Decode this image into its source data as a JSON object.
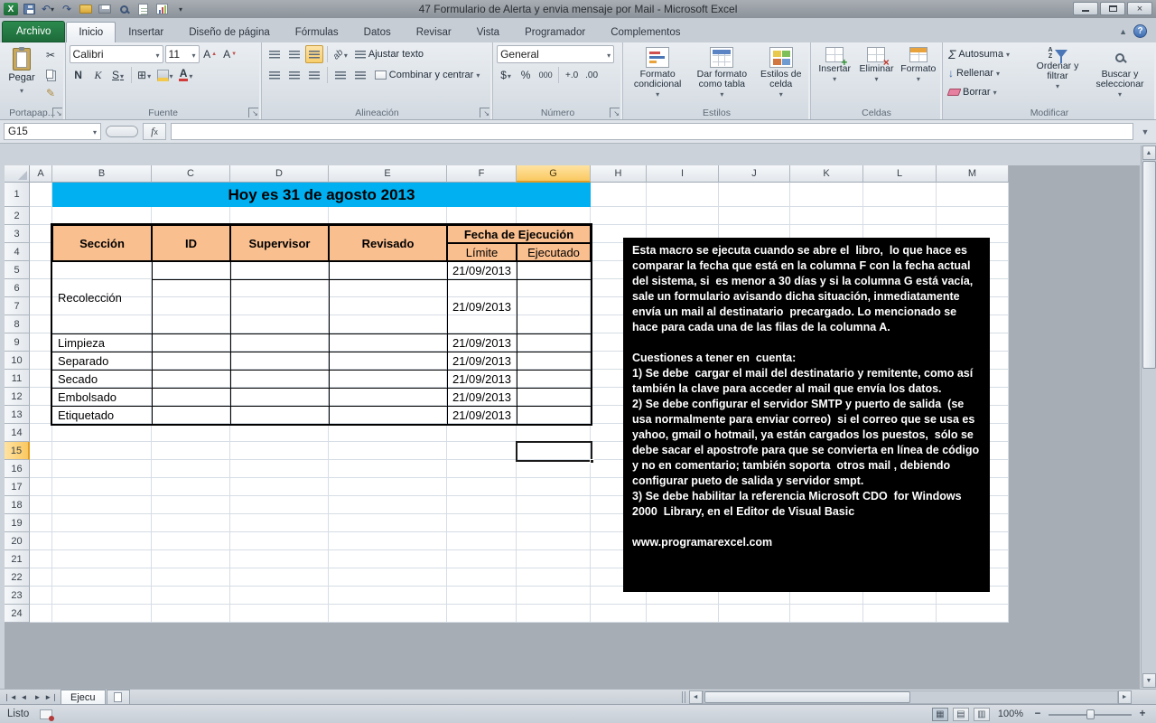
{
  "window": {
    "title": "47 Formulario de Alerta y envia mensaje por Mail  -  Microsoft Excel"
  },
  "ribbon": {
    "file_tab": "Archivo",
    "tabs": [
      "Inicio",
      "Insertar",
      "Diseño de página",
      "Fórmulas",
      "Datos",
      "Revisar",
      "Vista",
      "Programador",
      "Complementos"
    ],
    "active_tab": "Inicio",
    "groups": {
      "clipboard": {
        "label": "Portapap...",
        "paste": "Pegar"
      },
      "font": {
        "label": "Fuente",
        "font_name": "Calibri",
        "font_size": "11",
        "bold": "N",
        "italic": "K",
        "underline": "S"
      },
      "alignment": {
        "label": "Alineación",
        "wrap_text": "Ajustar texto",
        "merge_center": "Combinar y centrar"
      },
      "number": {
        "label": "Número",
        "format": "General",
        "currency": "$",
        "percent": "%",
        "thousands": "000",
        "increase_decimal": "+.0",
        "decrease_decimal": ".00"
      },
      "styles": {
        "label": "Estilos",
        "conditional": "Formato condicional",
        "format_table": "Dar formato como tabla",
        "cell_styles": "Estilos de celda"
      },
      "cells": {
        "label": "Celdas",
        "insert": "Insertar",
        "delete": "Eliminar",
        "format": "Formato"
      },
      "editing": {
        "label": "Modificar",
        "autosum": "Autosuma",
        "fill": "Rellenar",
        "clear": "Borrar",
        "sort": "Ordenar y filtrar",
        "find": "Buscar y seleccionar"
      }
    },
    "help": "?"
  },
  "icons": {
    "cut": "✂",
    "format_painter": "✎",
    "borders": "⊞",
    "undo": "↶",
    "redo": "↷",
    "autosum_glyph": "Σ",
    "fill_glyph": "↓",
    "excel_logo": "X"
  },
  "formula_bar": {
    "name_box": "G15",
    "formula": ""
  },
  "sheet": {
    "columns": [
      "A",
      "B",
      "C",
      "D",
      "E",
      "F",
      "G",
      "H",
      "I",
      "J",
      "K",
      "L",
      "M"
    ],
    "row_count": 24,
    "selected_column": "G",
    "selected_row": 15,
    "banner": "Hoy es 31 de agosto 2013",
    "table": {
      "headers": {
        "seccion": "Sección",
        "id": "ID",
        "supervisor": "Supervisor",
        "revisado": "Revisado",
        "fecha": "Fecha de Ejecución",
        "limite": "Límite",
        "ejecutado": "Ejecutado"
      },
      "recoleccion": {
        "name": "Recolección",
        "date1": "21/09/2013",
        "date2": "21/09/2013"
      },
      "rows": [
        {
          "name": "Limpieza",
          "date": "21/09/2013"
        },
        {
          "name": "Separado",
          "date": "21/09/2013"
        },
        {
          "name": "Secado",
          "date": "21/09/2013"
        },
        {
          "name": "Embolsado",
          "date": "21/09/2013"
        },
        {
          "name": "Etiquetado",
          "date": "21/09/2013"
        }
      ]
    },
    "info_box": {
      "paragraphs": [
        "Esta macro se ejecuta cuando se abre el  libro,  lo que hace es comparar la fecha que está en la columna F con la fecha actual del sistema, si  es menor a 30 días y si la columna G está vacía, sale un formulario avisando dicha situación, inmediatamente envía un mail al destinatario  precargado. Lo mencionado se hace para cada una de las filas de la columna A.",
        "",
        "Cuestiones a tener en  cuenta:",
        "1) Se debe  cargar el mail del destinatario y remitente, como así también la clave para acceder al mail que envía los datos.",
        "2) Se debe configurar el servidor SMTP y puerto de salida  (se usa normalmente para enviar correo)  si el correo que se usa es yahoo, gmail o hotmail, ya están cargados los puestos,  sólo se debe sacar el apostrofe para que se convierta en línea de código y no en comentario; también soporta  otros mail , debiendo configurar pueto de salida y servidor smpt.",
        "3) Se debe habilitar la referencia Microsoft CDO  for Windows 2000  Library, en el Editor de Visual Basic",
        "",
        "www.programarexcel.com"
      ]
    }
  },
  "sheet_tabs": {
    "active": "Ejecu"
  },
  "status_bar": {
    "status": "Listo",
    "zoom": "100%"
  },
  "colors": {
    "banner_bg": "#00B0F0",
    "table_header_bg": "#FABF8F",
    "info_box_bg": "#000000",
    "file_tab_bg": "#217346",
    "selection_border": "#1A1A1A"
  }
}
